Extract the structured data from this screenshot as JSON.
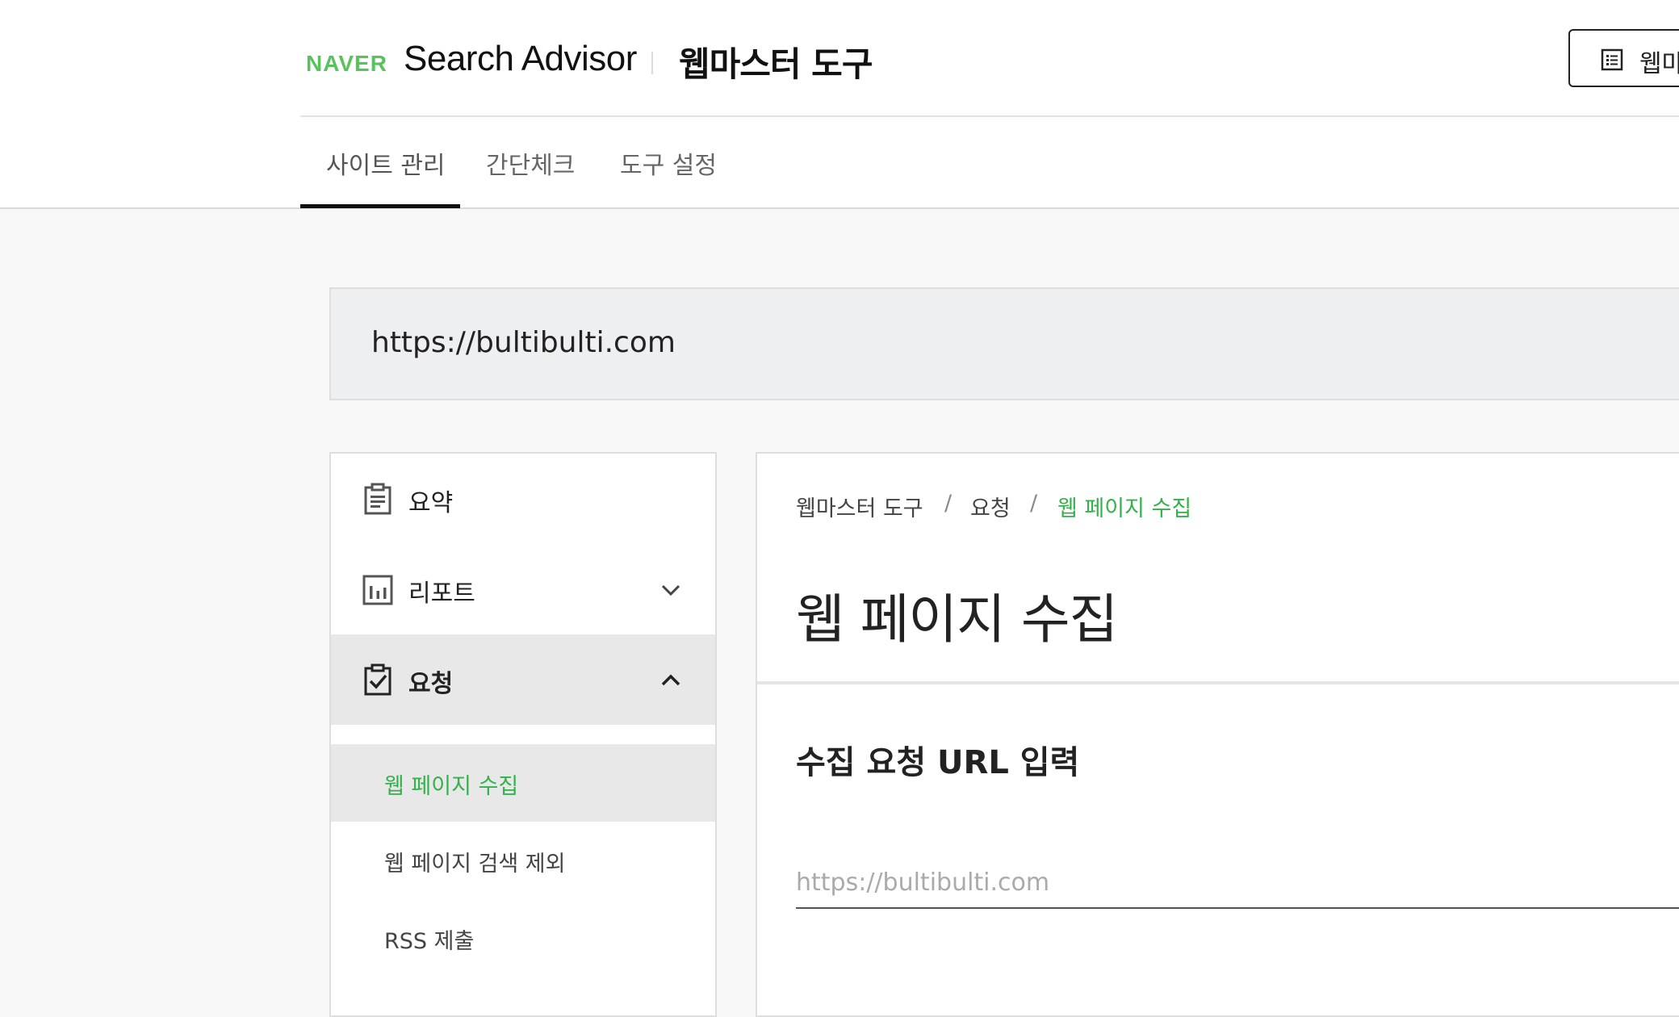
{
  "header": {
    "brand": "NAVER",
    "product": "Search Advisor",
    "subtitle": "웹마스터 도구",
    "top_button_label": "웹마",
    "top_button_icon": "list-icon"
  },
  "nav": {
    "tabs": [
      {
        "label": "사이트 관리",
        "active": true
      },
      {
        "label": "간단체크",
        "active": false
      },
      {
        "label": "도구 설정",
        "active": false
      }
    ]
  },
  "site": {
    "url": "https://bultibulti.com"
  },
  "sidebar": {
    "items": [
      {
        "label": "요약",
        "icon": "clipboard-icon",
        "expandable": false
      },
      {
        "label": "리포트",
        "icon": "bar-chart-icon",
        "expandable": true,
        "expanded": false
      },
      {
        "label": "요청",
        "icon": "clipboard-check-icon",
        "expandable": true,
        "expanded": true
      }
    ],
    "sub_items": [
      {
        "label": "웹 페이지 수집",
        "active": true
      },
      {
        "label": "웹 페이지 검색 제외",
        "active": false
      },
      {
        "label": "RSS 제출",
        "active": false
      }
    ]
  },
  "main": {
    "breadcrumb": [
      "웹마스터 도구",
      "요청",
      "웹 페이지 수집"
    ],
    "breadcrumb_separator": "/",
    "title": "웹 페이지 수집",
    "section_title": "수집 요청 URL 입력",
    "url_input": {
      "value": "",
      "placeholder": "https://bultibulti.com"
    }
  },
  "colors": {
    "brand_green": "#58c25d",
    "active_green": "#34b24a",
    "active_bg": "#e8e8e8"
  }
}
